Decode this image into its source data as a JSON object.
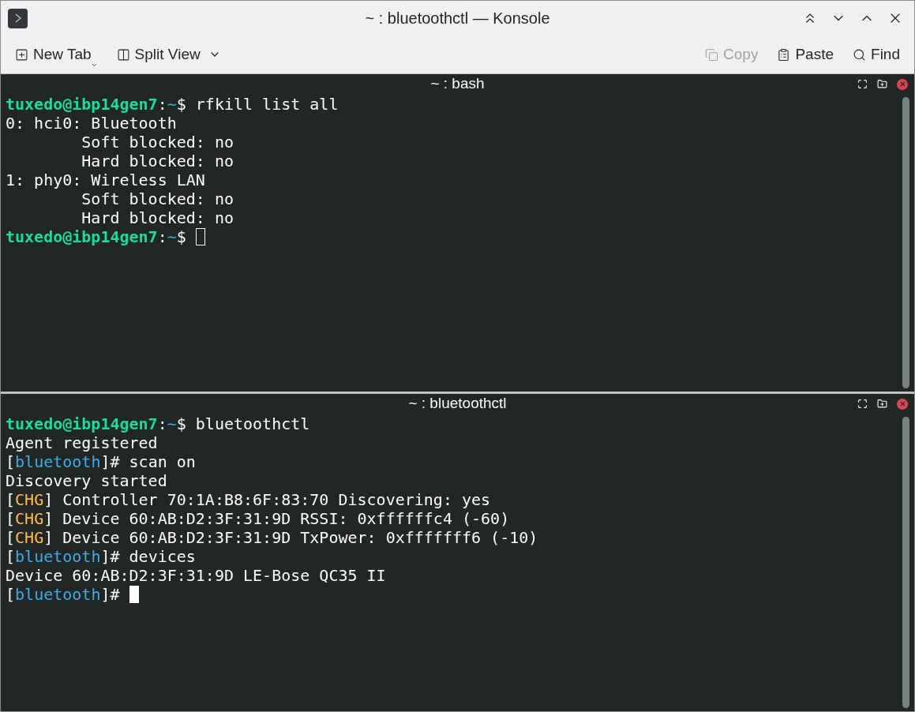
{
  "window": {
    "title": "~ : bluetoothctl — Konsole"
  },
  "toolbar": {
    "left": [
      {
        "label": "New Tab",
        "kind": "new-tab",
        "disabled": false
      },
      {
        "label": "Split View",
        "kind": "split-view",
        "disabled": false
      }
    ],
    "right": [
      {
        "label": "Copy",
        "kind": "copy",
        "disabled": true
      },
      {
        "label": "Paste",
        "kind": "paste",
        "disabled": false
      },
      {
        "label": "Find",
        "kind": "find",
        "disabled": false
      }
    ]
  },
  "panes": [
    {
      "title": "~ : bash",
      "focused": false,
      "lines": [
        [
          {
            "kind": "user",
            "text": "tuxedo@ibp14gen7"
          },
          {
            "kind": "plain",
            "text": ":"
          },
          {
            "kind": "path",
            "text": "~"
          },
          {
            "kind": "plain",
            "text": "$ rfkill list all"
          }
        ],
        [
          {
            "kind": "plain",
            "text": "0: hci0: Bluetooth"
          }
        ],
        [
          {
            "kind": "plain",
            "text": "        Soft blocked: no"
          }
        ],
        [
          {
            "kind": "plain",
            "text": "        Hard blocked: no"
          }
        ],
        [
          {
            "kind": "plain",
            "text": "1: phy0: Wireless LAN"
          }
        ],
        [
          {
            "kind": "plain",
            "text": "        Soft blocked: no"
          }
        ],
        [
          {
            "kind": "plain",
            "text": "        Hard blocked: no"
          }
        ],
        [
          {
            "kind": "user",
            "text": "tuxedo@ibp14gen7"
          },
          {
            "kind": "plain",
            "text": ":"
          },
          {
            "kind": "path",
            "text": "~"
          },
          {
            "kind": "plain",
            "text": "$ "
          }
        ]
      ]
    },
    {
      "title": "~ : bluetoothctl",
      "focused": true,
      "lines": [
        [
          {
            "kind": "user",
            "text": "tuxedo@ibp14gen7"
          },
          {
            "kind": "plain",
            "text": ":"
          },
          {
            "kind": "path",
            "text": "~"
          },
          {
            "kind": "plain",
            "text": "$ bluetoothctl"
          }
        ],
        [
          {
            "kind": "plain",
            "text": "Agent registered"
          }
        ],
        [
          {
            "kind": "plain",
            "text": "["
          },
          {
            "kind": "path",
            "text": "bluetooth"
          },
          {
            "kind": "plain",
            "text": "]# scan on"
          }
        ],
        [
          {
            "kind": "plain",
            "text": "Discovery started"
          }
        ],
        [
          {
            "kind": "plain",
            "text": "["
          },
          {
            "kind": "change",
            "text": "CHG"
          },
          {
            "kind": "plain",
            "text": "] Controller 70:1A:B8:6F:83:70 Discovering: yes"
          }
        ],
        [
          {
            "kind": "plain",
            "text": "["
          },
          {
            "kind": "change",
            "text": "CHG"
          },
          {
            "kind": "plain",
            "text": "] Device 60:AB:D2:3F:31:9D RSSI: 0xffffffc4 (-60)"
          }
        ],
        [
          {
            "kind": "plain",
            "text": "["
          },
          {
            "kind": "change",
            "text": "CHG"
          },
          {
            "kind": "plain",
            "text": "] Device 60:AB:D2:3F:31:9D TxPower: 0xfffffff6 (-10)"
          }
        ],
        [
          {
            "kind": "plain",
            "text": "["
          },
          {
            "kind": "path",
            "text": "bluetooth"
          },
          {
            "kind": "plain",
            "text": "]# devices"
          }
        ],
        [
          {
            "kind": "plain",
            "text": "Device 60:AB:D2:3F:31:9D LE-Bose QC35 II"
          }
        ],
        [
          {
            "kind": "plain",
            "text": "["
          },
          {
            "kind": "path",
            "text": "bluetooth"
          },
          {
            "kind": "plain",
            "text": "]# "
          }
        ]
      ]
    }
  ]
}
